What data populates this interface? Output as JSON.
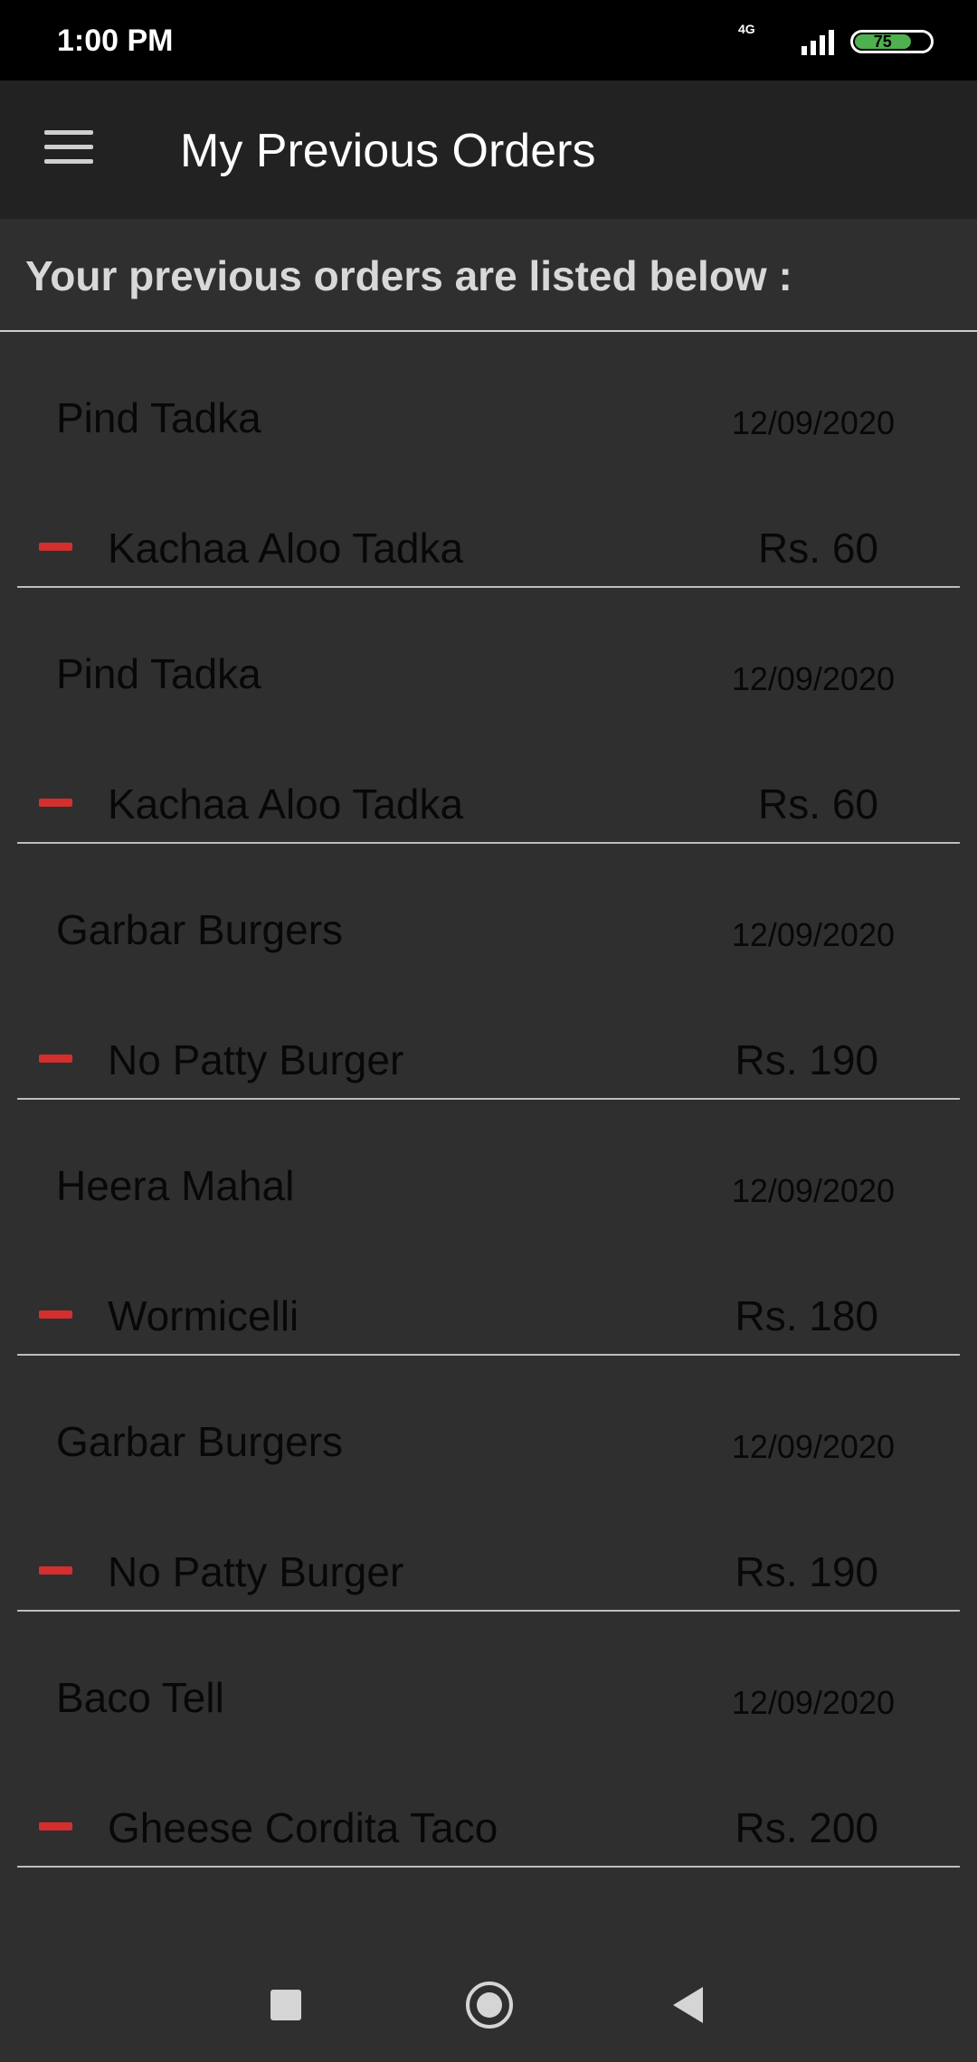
{
  "status_bar": {
    "time": "1:00 PM",
    "network": "4G",
    "battery": "75"
  },
  "app_bar": {
    "title": "My Previous Orders",
    "menu_icon": "hamburger-menu-icon"
  },
  "subheader": {
    "text": "Your previous orders are listed below :"
  },
  "orders": [
    {
      "restaurant": "Pind Tadka",
      "date": "12/09/2020",
      "item": "Kachaa Aloo Tadka",
      "price": "Rs. 60"
    },
    {
      "restaurant": "Pind Tadka",
      "date": "12/09/2020",
      "item": "Kachaa Aloo Tadka",
      "price": "Rs. 60"
    },
    {
      "restaurant": "Garbar Burgers",
      "date": "12/09/2020",
      "item": "No Patty Burger",
      "price": "Rs. 190"
    },
    {
      "restaurant": "Heera Mahal",
      "date": "12/09/2020",
      "item": "Wormicelli",
      "price": "Rs. 180"
    },
    {
      "restaurant": "Garbar Burgers",
      "date": "12/09/2020",
      "item": "No Patty Burger",
      "price": "Rs. 190"
    },
    {
      "restaurant": "Baco Tell",
      "date": "12/09/2020",
      "item": "Gheese Cordita Taco",
      "price": "Rs. 200"
    }
  ],
  "colors": {
    "accent": "#d32f2f",
    "background": "#2f2f2f",
    "app_bar": "#222222"
  },
  "nav_icons": [
    "recents-icon",
    "home-icon",
    "back-icon"
  ]
}
